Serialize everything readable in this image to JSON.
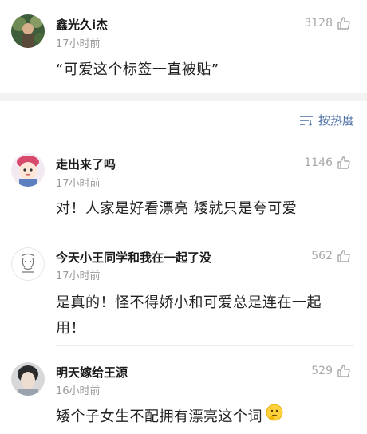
{
  "top_comment": {
    "name": "鑫光久i杰",
    "time": "17小时前",
    "likes": "3128",
    "text": "“可爱这个标签一直被贴”"
  },
  "sort": {
    "label": "按热度",
    "icon": "sort-lines-icon"
  },
  "comments": [
    {
      "name": "走出来了吗",
      "time": "17小时前",
      "likes": "1146",
      "text": "对！人家是好看漂亮 矮就只是夸可爱"
    },
    {
      "name": "今天小王同学和我在一起了没",
      "time": "17小时前",
      "likes": "562",
      "text": "是真的！怪不得娇小和可爱总是连在一起用！"
    },
    {
      "name": "明天嫁给王源",
      "time": "16小时前",
      "likes": "529",
      "text": "矮个子女生不配拥有漂亮这个词"
    }
  ],
  "colors": {
    "accent": "#4a6da4",
    "muted": "#9a9a9a",
    "separator": "#f2f2f2"
  }
}
